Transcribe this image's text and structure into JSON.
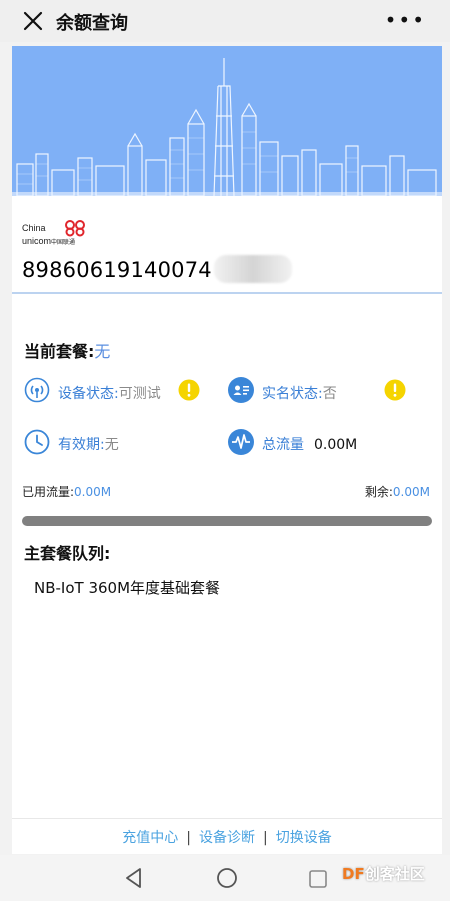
{
  "header": {
    "title": "余额查询",
    "more": "•••"
  },
  "brand": {
    "line1": "China",
    "line2": "unicom",
    "line2_cn": "中国联通"
  },
  "sim": {
    "iccid": "89860619140074"
  },
  "package": {
    "label": "当前套餐:",
    "value": "无"
  },
  "status": {
    "device_label": "设备状态:",
    "device_value": "可测试",
    "realname_label": "实名状态:",
    "realname_value": "否",
    "validity_label": "有效期:",
    "validity_value": "无",
    "traffic_label": "总流量",
    "traffic_value": "0.00M"
  },
  "usage": {
    "used_label": "已用流量:",
    "used_value": "0.00M",
    "remain_label": "剩余:",
    "remain_value": "0.00M",
    "used_fraction": 0
  },
  "queue": {
    "title": "主套餐队列:",
    "items": [
      "NB-IoT 360M年度基础套餐"
    ]
  },
  "footer": {
    "link1": "充值中心",
    "sep": "|",
    "link2": "设备诊断",
    "link3": "切换设备"
  },
  "watermark": {
    "df": "DF",
    "rest": "创客社区"
  },
  "colors": {
    "banner": "#7fb0f6",
    "accent": "#4a90e2",
    "link": "#4ba3e0",
    "warning": "#f5d400",
    "icon_blue": "#3a86d8"
  }
}
